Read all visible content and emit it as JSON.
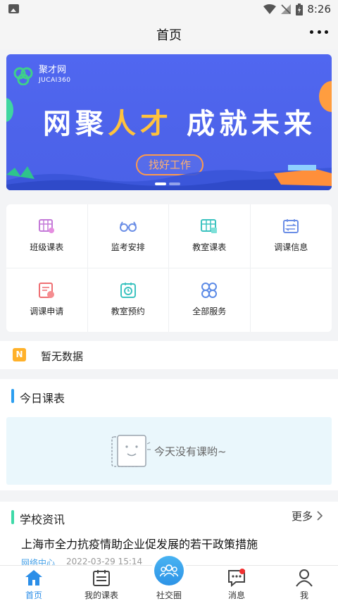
{
  "status_bar": {
    "time": "8:26"
  },
  "header": {
    "title": "首页"
  },
  "banner": {
    "logo_name": "聚才网",
    "logo_sub": "JUCAI360",
    "slogan_part1": "网聚",
    "slogan_highlight": "人才",
    "slogan_part2": "成就未来",
    "cta_label": "找好工作"
  },
  "services": [
    {
      "label": "班级课表",
      "icon": "class-schedule-icon"
    },
    {
      "label": "监考安排",
      "icon": "glasses-icon"
    },
    {
      "label": "教室课表",
      "icon": "classroom-schedule-icon"
    },
    {
      "label": "调课信息",
      "icon": "swap-info-icon"
    },
    {
      "label": "调课申请",
      "icon": "apply-form-icon"
    },
    {
      "label": "教室预约",
      "icon": "reservation-icon"
    },
    {
      "label": "全部服务",
      "icon": "all-services-icon"
    }
  ],
  "notice": {
    "badge": "N",
    "text": "暂无数据"
  },
  "today": {
    "title": "今日课表",
    "empty_text": "今天没有课哟~"
  },
  "news": {
    "title": "学校资讯",
    "more": "更多",
    "items": [
      {
        "title": "上海市全力抗疫情助企业促发展的若干政策措施",
        "source": "网络中心",
        "time": "2022-03-29 15:14"
      }
    ]
  },
  "tabbar": {
    "items": [
      {
        "label": "首页"
      },
      {
        "label": "我的课表"
      },
      {
        "label": "社交圈"
      },
      {
        "label": "消息"
      },
      {
        "label": "我"
      }
    ]
  },
  "colors": {
    "accent": "#2b8ee8",
    "banner": "#4d63ea",
    "highlight": "#ffc23d"
  }
}
